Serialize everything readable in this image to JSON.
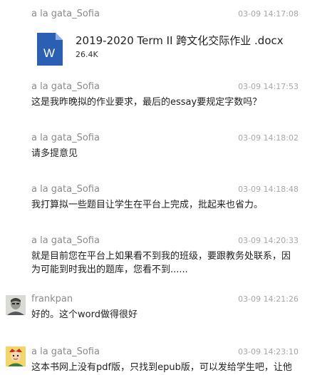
{
  "messages": [
    {
      "sender": "a la gata_Sofia",
      "time": "03-09 14:17:08",
      "file": {
        "name": "2019-2020 Term II 跨文化交际作业 .docx",
        "size": "26.4K",
        "icon_letter": "W"
      }
    },
    {
      "sender": "a la gata_Sofia",
      "time": "03-09 14:17:53",
      "text": "这是我昨晚拟的作业要求，最后的essay要规定字数吗？"
    },
    {
      "sender": "a la gata_Sofia",
      "time": "03-09 14:18:02",
      "text": "请多提意见"
    },
    {
      "sender": "a la gata_Sofia",
      "time": "03-09 14:18:48",
      "text": "我打算拟一些题目让学生在平台上完成，批起来也省力。"
    },
    {
      "sender": "a la gata_Sofia",
      "time": "03-09 14:20:33",
      "text_line1": "就是目前您在平台上如果看不到我的班级，要跟教务处联系，因",
      "text_line2": "为可能到时我出的题库，您看不到......"
    },
    {
      "sender": "frankpan",
      "time": "03-09 14:21:26",
      "text": "好的。这个word做得很好"
    },
    {
      "sender": "a la gata_Sofia",
      "time": "03-09 14:23:10",
      "text": "这本书网上没有pdf版，只找到epub版，可以发给学生吧，让他"
    }
  ],
  "colors": {
    "word_blue": "#2b5fb4",
    "word_fold": "#8fb0e4"
  }
}
